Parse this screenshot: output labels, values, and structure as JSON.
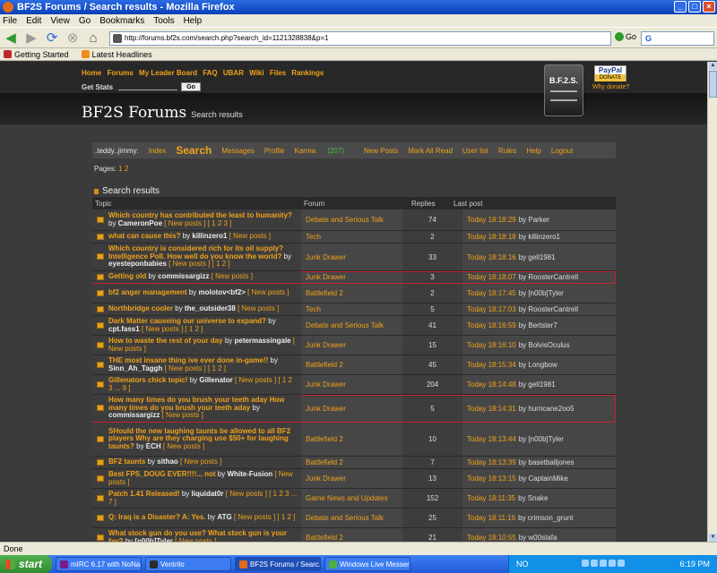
{
  "window": {
    "title": "BF2S Forums / Search results - Mozilla Firefox",
    "btn_min": "_",
    "btn_max": "□",
    "btn_close": "×"
  },
  "menu": [
    "File",
    "Edit",
    "View",
    "Go",
    "Bookmarks",
    "Tools",
    "Help"
  ],
  "nav": {
    "url": "http://forums.bf2s.com/search.php?search_id=1121328838&p=1",
    "go_label": "Go",
    "search_value": "G"
  },
  "bookmarks": [
    {
      "label": "Getting Started",
      "color": "#c0272d"
    },
    {
      "label": "Latest Headlines",
      "color": "#f08c1b"
    }
  ],
  "site": {
    "top_links": [
      "Home",
      "Forums",
      "My Leader Board",
      "FAQ",
      "UBAR",
      "Wiki",
      "Files",
      "Rankings"
    ],
    "get_stats_label": "Get Stats",
    "go_button": "Go",
    "logo_text": "B.F.2.S.",
    "paypal": "PayPal",
    "paypal_donate": "DONATE",
    "why_donate": "Why donate?",
    "title": "BF2S Forums",
    "subtitle": "Search results"
  },
  "user_nav": {
    "user": ".teddy..jimmy:",
    "items": [
      "Index",
      "Search",
      "Messages",
      "Profile"
    ],
    "karma_label": "Karma",
    "karma_value": "(207)",
    "items2": [
      "New Posts",
      "Mark All Read",
      "User list",
      "Rules",
      "Help",
      "Logout"
    ]
  },
  "pages": {
    "label": "Pages:",
    "current": "1",
    "next": "2"
  },
  "results": {
    "heading": "Search results",
    "columns": [
      "Topic",
      "Forum",
      "Replies",
      "Last post"
    ],
    "rows": [
      {
        "topic": "Which country has contributed the least to humanity?",
        "by": "CameronPoe",
        "np": "[ New posts ] [ 1 2 3 ]",
        "forum": "Debate and Serious Talk",
        "replies": "74",
        "time": "Today 18:18:29",
        "user": "Parker",
        "hl": false,
        "h": 24
      },
      {
        "topic": "what can cause this?",
        "by": "killinzero1",
        "np": "[ New posts ]",
        "forum": "Tech",
        "replies": "2",
        "time": "Today 18:18:18",
        "user": "killinzero1",
        "hl": false,
        "h": 14
      },
      {
        "topic": "Which country is considered rich for its oil supply? Intelligence Poll. How well do you know the world?",
        "by": "eyesteponbabies",
        "np": "[ New posts ] [ 1 2 ]",
        "forum": "Junk Drawer",
        "replies": "33",
        "time": "Today 18:18:16",
        "user": "gell1981",
        "hl": false,
        "h": 31
      },
      {
        "topic": "Getting old",
        "by": "commissargizz",
        "np": "[ New posts ]",
        "forum": "Junk Drawer",
        "replies": "3",
        "time": "Today 18:18:07",
        "user": "RoosterCantrell",
        "hl": true,
        "h": 14
      },
      {
        "topic": "bf2 anger management",
        "by": "molotov<bf2>",
        "np": "[ New posts ]",
        "forum": "Battlefield 2",
        "replies": "2",
        "time": "Today 18:17:45",
        "user": "[n00b]Tyler",
        "hl": false,
        "h": 22
      },
      {
        "topic": "Northbridge cooler",
        "by": "the_outsider38",
        "np": "[ New posts ]",
        "forum": "Tech",
        "replies": "5",
        "time": "Today 18:17:03",
        "user": "RoosterCantrell",
        "hl": false,
        "h": 14
      },
      {
        "topic": "Dark Matter causeing our universe to expand?",
        "by": "cpt.fass1",
        "np": "[ New posts ] [ 1 2 ]",
        "forum": "Debate and Serious Talk",
        "replies": "41",
        "time": "Today 18:16:59",
        "user": "Bertster7",
        "hl": false,
        "h": 22
      },
      {
        "topic": "How to waste the rest of your day",
        "by": "petermassingale",
        "np": "[ New posts ]",
        "forum": "Junk Drawer",
        "replies": "15",
        "time": "Today 18:16:10",
        "user": "BolvisOculus",
        "hl": false,
        "h": 22
      },
      {
        "topic": "THE most insane thing ive ever done in-game!!",
        "by": "Sinn_Ah_Taggh",
        "np": "[ New posts ] [ 1 2 ]",
        "forum": "Battlefield 2",
        "replies": "45",
        "time": "Today 18:15:34",
        "user": "Longbow",
        "hl": false,
        "h": 22
      },
      {
        "topic": "Gillenators chick topic!",
        "by": "Gillenator",
        "np": "[ New posts ] [ 1 2 3 ... 9 ]",
        "forum": "Junk Drawer",
        "replies": "204",
        "time": "Today 18:14:48",
        "user": "gell1981",
        "hl": false,
        "h": 22
      },
      {
        "topic": "How many times do you brush your teeth aday How many times do you brush your teeth aday",
        "by": "commissargizz",
        "np": "[ New posts ]",
        "forum": "Junk Drawer",
        "replies": "5",
        "time": "Today 18:14:31",
        "user": "hurricane2oo5",
        "hl": true,
        "h": 31
      },
      {
        "topic": "SHould the new laughing taunts be allowed to all BF2 players Why are they charging use $50+ for laughing taunts?",
        "by": "ECH",
        "np": "[ New posts ]",
        "forum": "Battlefield 2",
        "replies": "10",
        "time": "Today 18:13:44",
        "user": "[n00b]Tyler",
        "hl": false,
        "h": 38
      },
      {
        "topic": "BF2 taunts",
        "by": "sithao",
        "np": "[ New posts ]",
        "forum": "Battlefield 2",
        "replies": "7",
        "time": "Today 18:13:39",
        "user": "basetballjones",
        "hl": false,
        "h": 14
      },
      {
        "topic": "Best FPS_DOUG EVER!!!!... not",
        "by": "White-Fusion",
        "np": "[ New posts ]",
        "forum": "Junk Drawer",
        "replies": "13",
        "time": "Today 18:13:15",
        "user": "CaptainMike",
        "hl": false,
        "h": 22
      },
      {
        "topic": "Patch 1.41 Released!",
        "by": "liquidat0r",
        "np": "[ New posts ] [ 1 2 3 ... 7 ]",
        "forum": "Game News and Updates",
        "replies": "152",
        "time": "Today 18:11:35",
        "user": "Snake",
        "hl": false,
        "h": 22
      },
      {
        "topic": "Q: Iraq is a Disaster? A: Yes.",
        "by": "ATG",
        "np": "[ New posts ] [ 1 2 ]",
        "forum": "Debate and Serious Talk",
        "replies": "25",
        "time": "Today 18:11:16",
        "user": "crimson_grunt",
        "hl": false,
        "h": 22
      },
      {
        "topic": "What stock gun do you use? What stock gun is your fav?",
        "by": "[n00b]Tyler",
        "np": "[ New posts ]",
        "forum": "Battlefield 2",
        "replies": "21",
        "time": "Today 18:10:55",
        "user": "w00stafa",
        "hl": false,
        "h": 22
      }
    ]
  },
  "statusbar": "Done",
  "taskbar": {
    "start": "start",
    "items": [
      {
        "label": "mIRC 6.17 with NoNa...",
        "color": "#7a1a8c"
      },
      {
        "label": "Ventrilo",
        "color": "#2a2a2a"
      },
      {
        "label": "BF2S Forums / Searc...",
        "color": "#e06a1a"
      },
      {
        "label": "Windows Live Messen...",
        "color": "#4cae3c"
      }
    ],
    "lang": "NO",
    "clock": "6:19 PM"
  },
  "colors": {
    "accent": "#f0a21b",
    "highlight_border": "#c0272d",
    "karma": "#4cbf3f"
  }
}
